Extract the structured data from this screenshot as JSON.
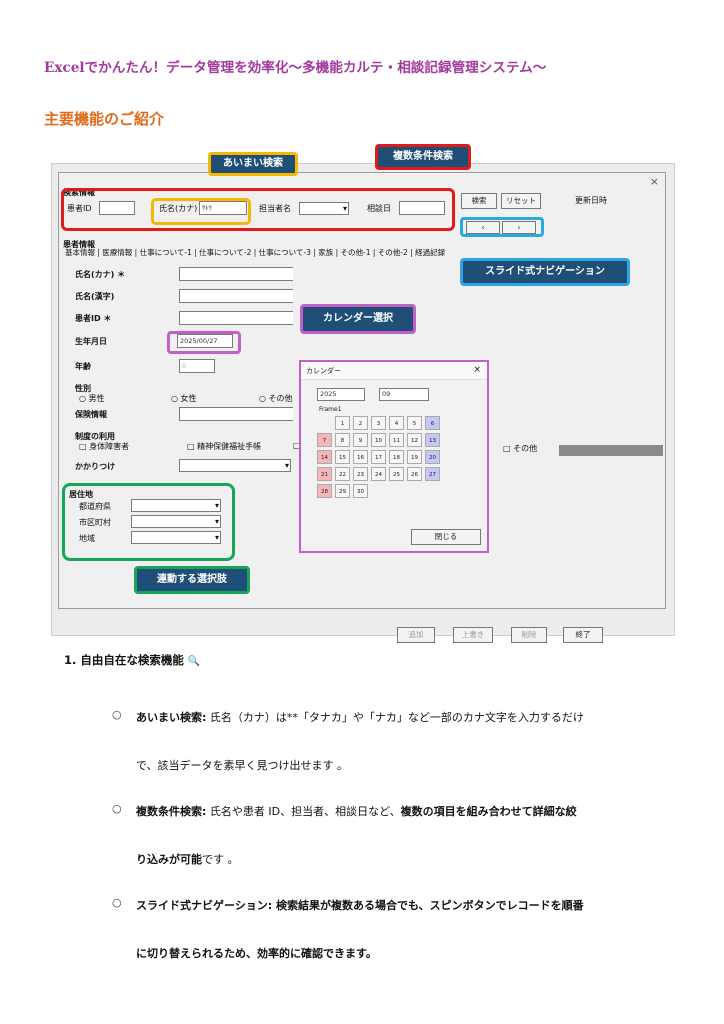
{
  "doc": {
    "title": "Excelでかんたん！データ管理を効率化〜多機能カルテ・相談記録管理システム〜",
    "section_heading": "主要機能のご紹介"
  },
  "form": {
    "close": "×",
    "search_group": "検索情報",
    "patient_id_label": "患者ID",
    "name_kana_label": "氏名(カナ)",
    "name_kana_value": "ｻﾄｳ",
    "staff_label": "担当者名",
    "consult_date_label": "相談日",
    "search_btn": "検索",
    "reset_btn": "リセット",
    "updated_label": "更新日時",
    "prev_btn": "‹",
    "next_btn": "›",
    "patient_group": "患者情報",
    "tabs": "基本情報 | 医療情報 | 仕事について-1 | 仕事について-2 | 仕事について-3 | 家族 | その他-1 | その他-2 | 経過記録",
    "fields": {
      "name_kana": "氏名(カナ) ＊",
      "name_kanji": "氏名(漢字)",
      "patient_id": "患者ID ＊",
      "birthday": "生年月日",
      "birthday_value": "2025/00/27",
      "age": "年齢",
      "age_value": "0",
      "gender": "性別",
      "male": "○ 男性",
      "female": "○ 女性",
      "other": "○ その他",
      "insurance": "保険情報",
      "system_use": "制度の利用",
      "disability": "□ 身体障害者",
      "mental": "□ 精神保健福祉手帳",
      "other_check": "□ その他",
      "clinic": "かかりつけ",
      "address": "居住地",
      "prefecture": "都道府県",
      "city": "市区町村",
      "area": "地域"
    },
    "calendar": {
      "title": "カレンダー",
      "close": "×",
      "year": "2025",
      "month": "09",
      "frame": "Frame1",
      "days": [
        "1",
        "2",
        "3",
        "4",
        "5",
        "6",
        "7",
        "8",
        "9",
        "10",
        "11",
        "12",
        "13",
        "14",
        "15",
        "16",
        "17",
        "18",
        "19",
        "20",
        "21",
        "22",
        "23",
        "24",
        "25",
        "26",
        "27",
        "28",
        "29",
        "30"
      ],
      "close_btn": "閉じる"
    },
    "bottom": {
      "add": "追加",
      "overwrite": "上書き",
      "delete": "削除",
      "exit": "終了"
    }
  },
  "callouts": {
    "fuzzy": "あいまい検索",
    "multi": "複数条件検索",
    "slide": "スライド式ナビゲーション",
    "calendar": "カレンダー選択",
    "linked": "連動する選択肢"
  },
  "body": {
    "item1": "1.  自由自在な検索機能",
    "item1_icon": "🔍",
    "b1_title": "あいまい検索:",
    "b1_text1": " 氏名（カナ）は**「タナカ」や「ナカ」など一部のカナ文字を入力するだけ",
    "b1_text2": "で、該当データを素早く見つけ出せます 。",
    "b2_title": "複数条件検索:",
    "b2_text1": " 氏名や患者 ID、担当者、相談日など、",
    "b2_bold1": "複数の項目を組み合わせて詳細な絞",
    "b2_bold2": "り込みが可能",
    "b2_text2": "です 。",
    "b3_title": "スライド式ナビゲーション:",
    "b3_text1": " 検索結果が複数ある場合でも、スピンボタンでレコードを順番",
    "b3_text2": "に切り替えられるため、効率的に確認できます。",
    "bullet": "○"
  }
}
